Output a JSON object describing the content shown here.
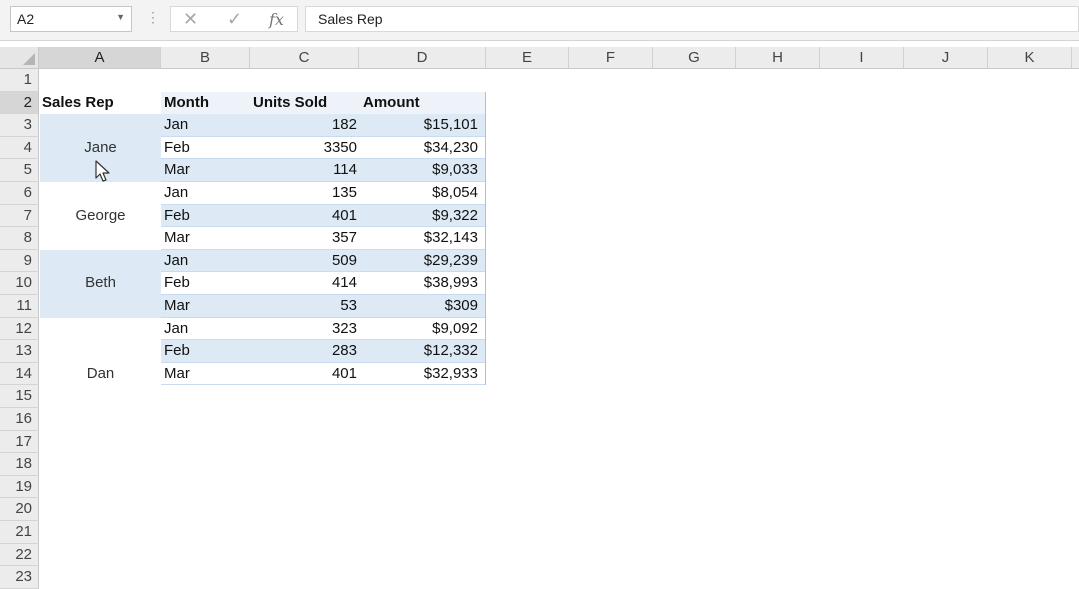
{
  "formula_bar": {
    "name_box": "A2",
    "name_box_dropdown_icon": "chevron-down-icon",
    "more_icon": "vertical-dots-icon",
    "cancel_icon": "close-icon",
    "cancel_glyph": "✕",
    "enter_icon": "check-icon",
    "enter_glyph": "✓",
    "fx_icon": "function-icon",
    "fx_label": "fx",
    "content": "Sales Rep"
  },
  "columns": [
    "A",
    "B",
    "C",
    "D",
    "E",
    "F",
    "G",
    "H",
    "I",
    "J",
    "K"
  ],
  "row_numbers": [
    "1",
    "2",
    "3",
    "4",
    "5",
    "6",
    "7",
    "8",
    "9",
    "10",
    "11",
    "12",
    "13",
    "14",
    "15",
    "16",
    "17",
    "18",
    "19",
    "20",
    "21",
    "22",
    "23"
  ],
  "table": {
    "headers": [
      "Sales Rep",
      "Month",
      "Units Sold",
      "Amount"
    ],
    "groups": [
      {
        "rep": "Jane",
        "rows": [
          [
            "Jan",
            "182",
            "$15,101"
          ],
          [
            "Feb",
            "3350",
            "$34,230"
          ],
          [
            "Mar",
            "114",
            "$9,033"
          ]
        ]
      },
      {
        "rep": "George",
        "rows": [
          [
            "Jan",
            "135",
            "$8,054"
          ],
          [
            "Feb",
            "401",
            "$9,322"
          ],
          [
            "Mar",
            "357",
            "$32,143"
          ]
        ]
      },
      {
        "rep": "Beth",
        "rows": [
          [
            "Jan",
            "509",
            "$29,239"
          ],
          [
            "Feb",
            "414",
            "$38,993"
          ],
          [
            "Mar",
            "53",
            "$309"
          ]
        ]
      },
      {
        "rep": "Dan",
        "rows": [
          [
            "Jan",
            "323",
            "$9,092"
          ],
          [
            "Feb",
            "283",
            "$12,332"
          ],
          [
            "Mar",
            "401",
            "$32,933"
          ]
        ]
      }
    ]
  },
  "colors": {
    "band": "#dde9f4",
    "table_border": "#9dc3e6"
  }
}
